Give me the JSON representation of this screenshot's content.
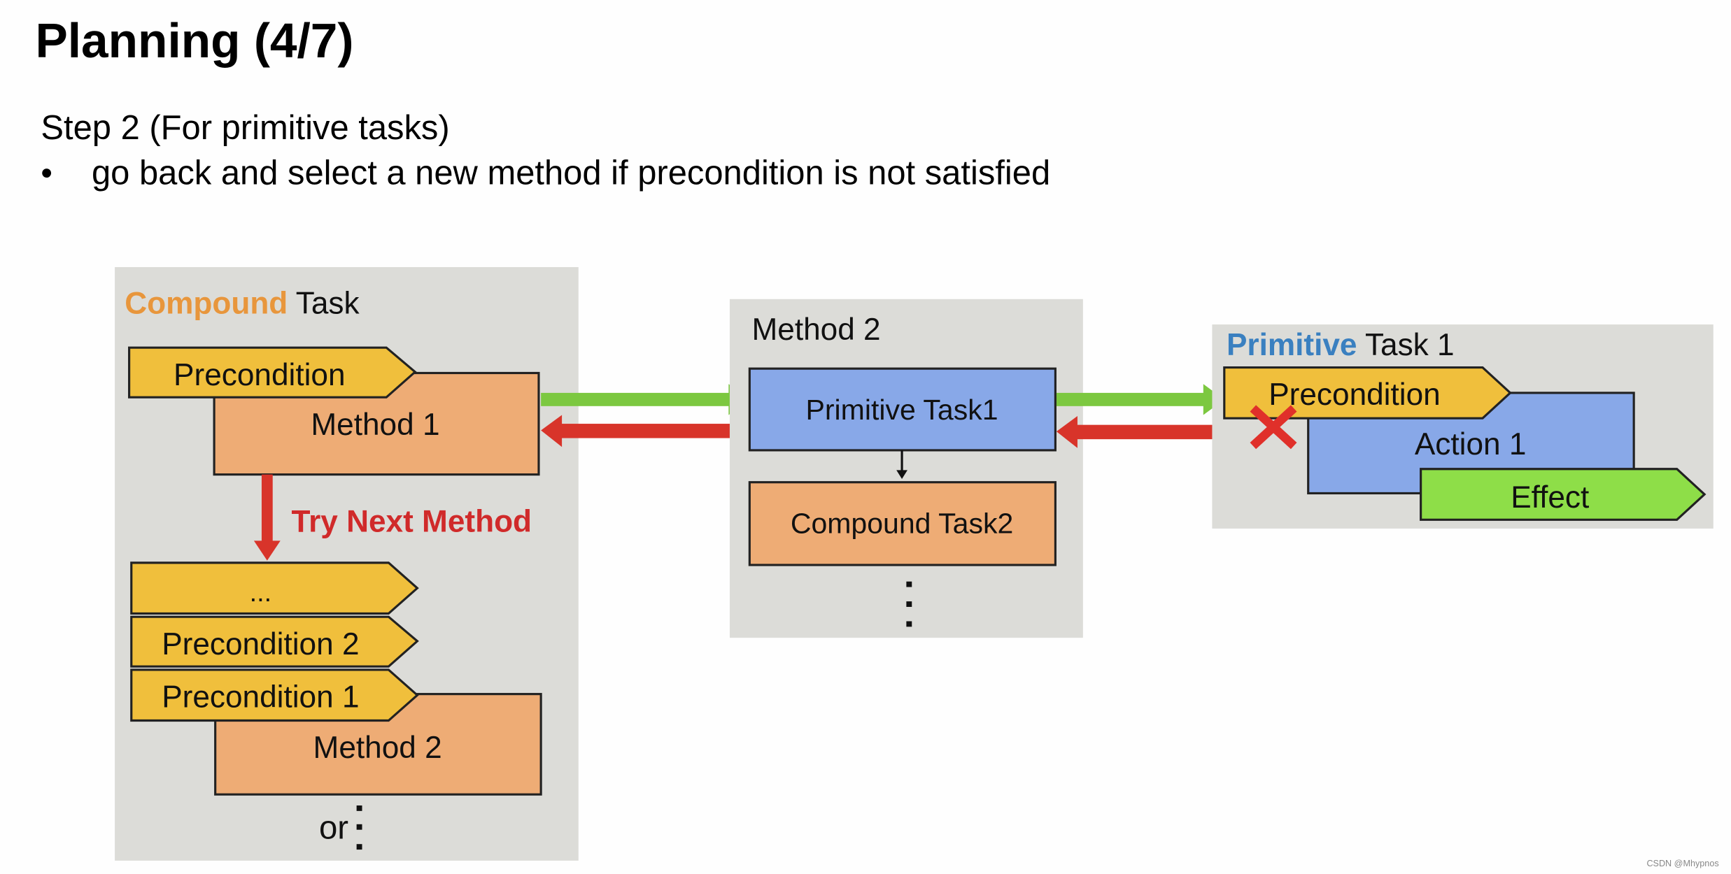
{
  "title": "Planning (4/7)",
  "step": "Step 2 (For primitive tasks)",
  "bullet": {
    "marker": "•",
    "text": "go back and select a new method if precondition is not satisfied"
  },
  "compound_panel": {
    "title_highlight": "Compound",
    "title_rest": " Task",
    "precondition": "Precondition",
    "method1": "Method 1",
    "try_next": "Try Next Method",
    "ellipsis": "...",
    "precondition2": "Precondition 2",
    "precondition1": "Precondition 1",
    "method2": "Method 2",
    "or": "or"
  },
  "method_panel": {
    "title": "Method 2",
    "primitive_task": "Primitive Task1",
    "compound_task": "Compound Task2"
  },
  "primitive_panel": {
    "title_highlight": "Primitive",
    "title_rest": " Task 1",
    "precondition": "Precondition",
    "action": "Action 1",
    "effect": "Effect"
  },
  "watermark": "CSDN @Mhypnos",
  "colors": {
    "panel": "#dcdcd8",
    "precondition": "#f0bf3c",
    "method": "#eeac75",
    "primitive": "#88a8e8",
    "effect": "#8ede48",
    "success_arrow": "#7cc840",
    "fail_arrow": "#d8342a",
    "compound_text": "#e8963c",
    "primitive_text": "#3a80c0",
    "try_next_text": "#d02a2a"
  },
  "icons": {
    "fail_mark": "x-mark-icon"
  }
}
